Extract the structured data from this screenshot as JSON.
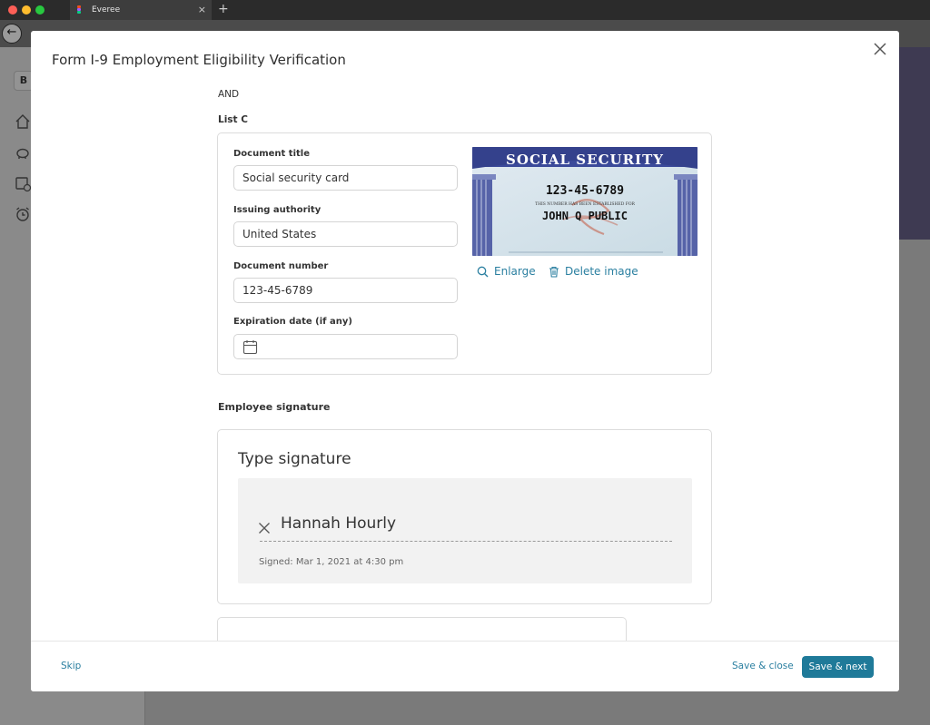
{
  "browser": {
    "tab_title": "Everee",
    "tab_close": "×",
    "new_tab": "+",
    "back": "←"
  },
  "app": {
    "sidebar_chip": "B"
  },
  "modal": {
    "title": "Form I-9 Employment Eligibility Verification",
    "and_label": "AND",
    "list_label": "List C",
    "document": {
      "title_label": "Document title",
      "title_value": "Social security card",
      "authority_label": "Issuing authority",
      "authority_value": "United States",
      "number_label": "Document number",
      "number_value": "123-45-6789",
      "expiration_label": "Expiration date (if any)",
      "expiration_value": ""
    },
    "image": {
      "card_header": "SOCIAL SECURITY",
      "card_number": "123-45-6789",
      "card_established": "THIS NUMBER HAS BEEN ESTABLISHED FOR",
      "card_name": "JOHN Q PUBLIC",
      "enlarge_label": "Enlarge",
      "delete_label": "Delete image"
    },
    "signature": {
      "section_label": "Employee signature",
      "heading": "Type signature",
      "name": "Hannah Hourly",
      "signed_text": "Signed: Mar 1, 2021 at 4:30 pm"
    },
    "footer": {
      "skip": "Skip",
      "save_close": "Save & close",
      "save_next": "Save & next"
    }
  },
  "colors": {
    "accent": "#1f7a99",
    "link": "#2a7fa0",
    "card_blue": "#3b4a9a"
  }
}
